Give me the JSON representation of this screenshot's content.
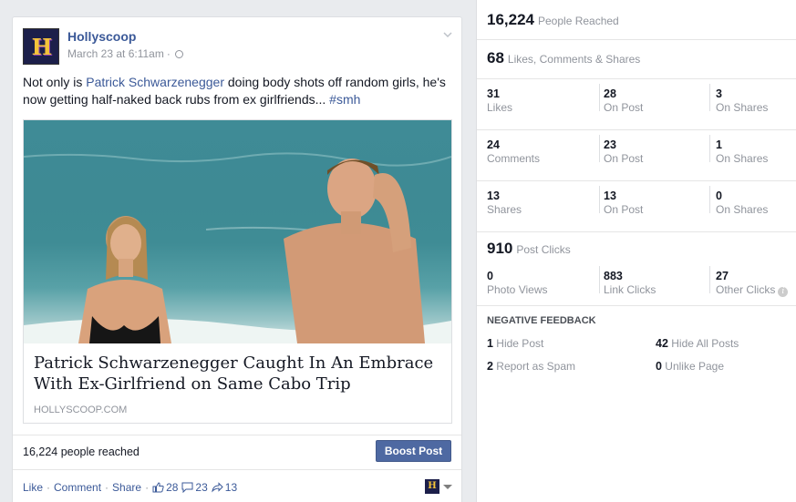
{
  "post": {
    "page_name": "Hollyscoop",
    "timestamp": "March 23 at 6:11am",
    "meta_sep": "·",
    "text_before": "Not only is ",
    "text_link": "Patrick Schwarzenegger",
    "text_after": " doing body shots off random girls, he's now getting half-naked back rubs from ex girlfriends... ",
    "hashtag": "#smh",
    "attachment": {
      "title": "Patrick Schwarzenegger Caught In An Embrace With Ex-Girlfriend on Same Cabo Trip",
      "domain": "HOLLYSCOOP.COM"
    },
    "reach_text": "16,224 people reached",
    "boost_label": "Boost Post",
    "actions": {
      "like": "Like",
      "comment": "Comment",
      "share": "Share",
      "sep": "·",
      "likes_count": "28",
      "comments_count": "23",
      "shares_count": "13"
    }
  },
  "insights": {
    "people_reached": {
      "value": "16,224",
      "label": "People Reached"
    },
    "engagement": {
      "value": "68",
      "label": "Likes, Comments & Shares"
    },
    "likes": [
      {
        "value": "31",
        "label": "Likes"
      },
      {
        "value": "28",
        "label": "On Post"
      },
      {
        "value": "3",
        "label": "On Shares"
      }
    ],
    "comments": [
      {
        "value": "24",
        "label": "Comments"
      },
      {
        "value": "23",
        "label": "On Post"
      },
      {
        "value": "1",
        "label": "On Shares"
      }
    ],
    "shares": [
      {
        "value": "13",
        "label": "Shares"
      },
      {
        "value": "13",
        "label": "On Post"
      },
      {
        "value": "0",
        "label": "On Shares"
      }
    ],
    "post_clicks": {
      "value": "910",
      "label": "Post Clicks"
    },
    "clicks": [
      {
        "value": "0",
        "label": "Photo Views"
      },
      {
        "value": "883",
        "label": "Link Clicks"
      },
      {
        "value": "27",
        "label": "Other Clicks"
      }
    ],
    "negative_feedback": {
      "title": "NEGATIVE FEEDBACK",
      "items": [
        {
          "value": "1",
          "label": "Hide Post"
        },
        {
          "value": "42",
          "label": "Hide All Posts"
        },
        {
          "value": "2",
          "label": "Report as Spam"
        },
        {
          "value": "0",
          "label": "Unlike Page"
        }
      ]
    }
  },
  "colors": {
    "link": "#3b5998",
    "boost": "#4e69a2",
    "muted": "#90949c"
  }
}
